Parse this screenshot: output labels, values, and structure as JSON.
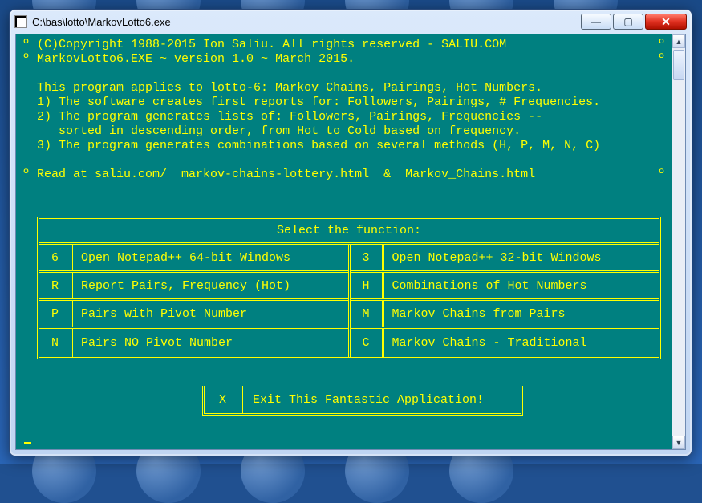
{
  "window": {
    "title": "C:\\bas\\lotto\\MarkovLotto6.exe"
  },
  "header": {
    "copyright": "(C)Copyright 1988-2015 Ion Saliu. All rights reserved - SALIU.COM",
    "version": "MarkovLotto6.EXE ~ version 1.0 ~ March 2015."
  },
  "body": {
    "intro": "This program applies to lotto-6: Markov Chains, Pairings, Hot Numbers.",
    "point1": "1) The software creates first reports for: Followers, Pairings, # Frequencies.",
    "point2a": "2) The program generates lists of: Followers, Pairings, Frequencies --",
    "point2b": "   sorted in descending order, from Hot to Cold based on frequency.",
    "point3": "3) The program generates combinations based on several methods (H, P, M, N, C)",
    "readat": "Read at saliu.com/  markov-chains-lottery.html  &  Markov_Chains.html"
  },
  "menu": {
    "title": "Select the function:",
    "left": [
      {
        "key": "6",
        "label": "Open Notepad++ 64-bit Windows"
      },
      {
        "key": "R",
        "label": "Report Pairs, Frequency (Hot)"
      },
      {
        "key": "P",
        "label": "Pairs with Pivot Number"
      },
      {
        "key": "N",
        "label": "Pairs NO  Pivot Number"
      }
    ],
    "right": [
      {
        "key": "3",
        "label": "Open Notepad++ 32-bit Windows"
      },
      {
        "key": "H",
        "label": "Combinations of Hot Numbers"
      },
      {
        "key": "M",
        "label": "Markov Chains from Pairs"
      },
      {
        "key": "C",
        "label": "Markov Chains - Traditional"
      }
    ],
    "exit": {
      "key": "X",
      "label": "Exit This Fantastic Application!"
    }
  },
  "colors": {
    "console_bg": "#008080",
    "console_fg": "#ffff00"
  }
}
